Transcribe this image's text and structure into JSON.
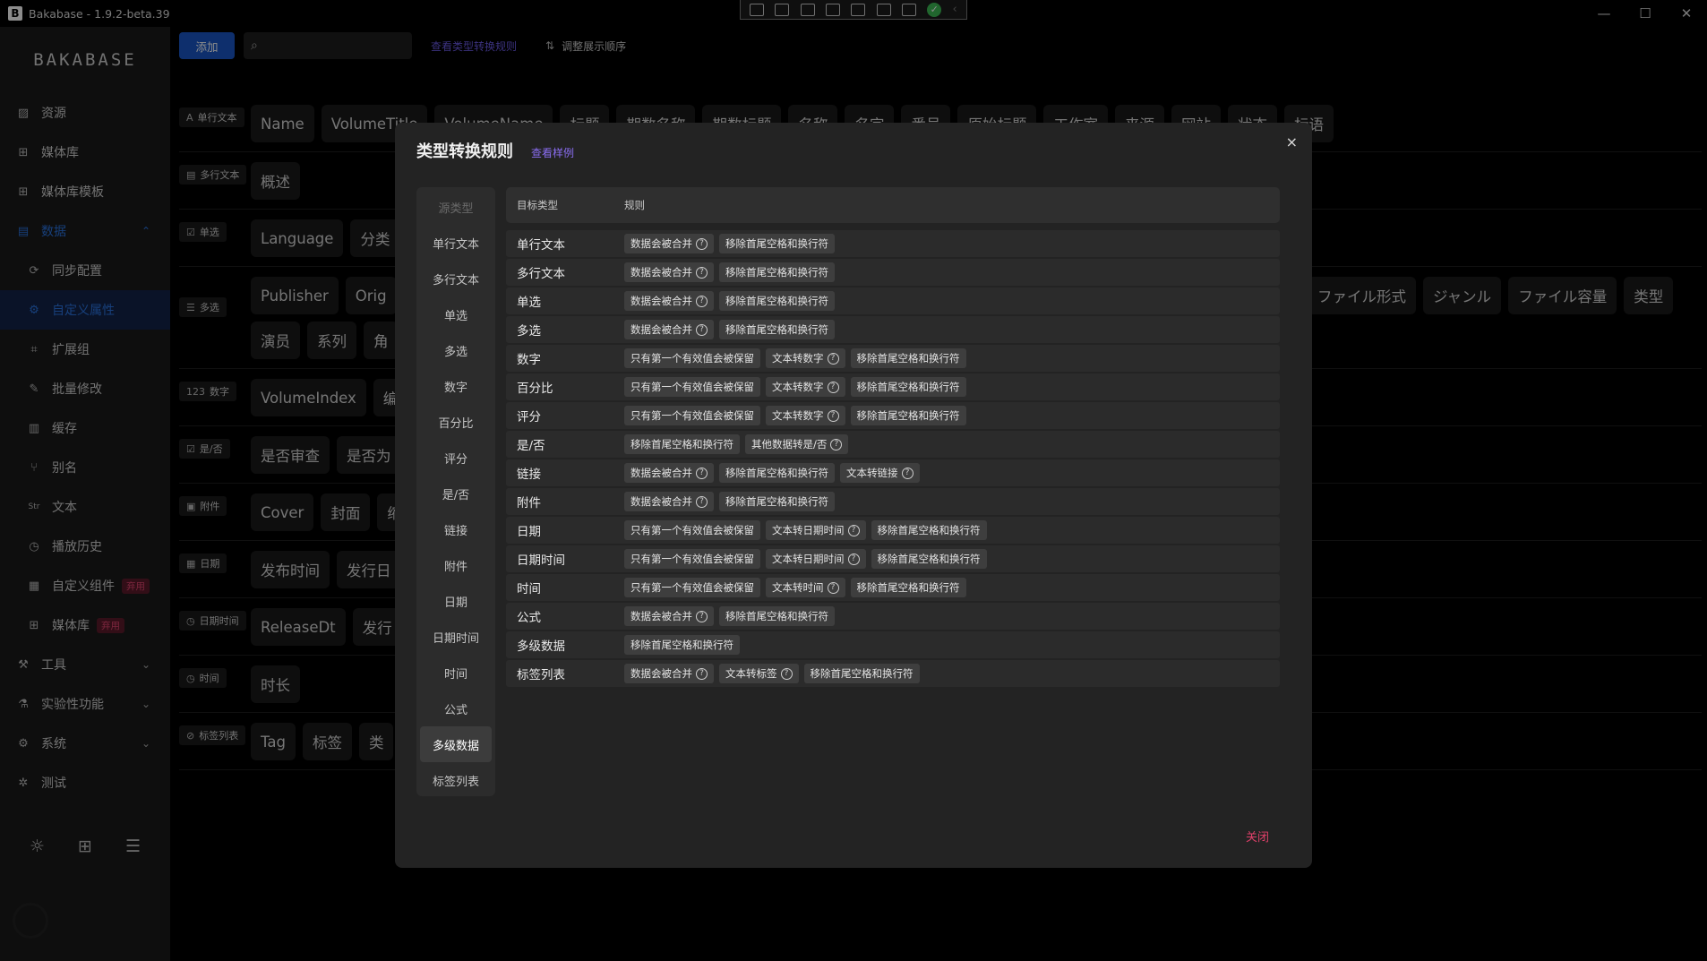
{
  "app": {
    "icon_letter": "B",
    "title": "Bakabase - 1.9.2-beta.39"
  },
  "window": {
    "minimize": "—",
    "maximize": "☐",
    "close": "✕"
  },
  "sidebar": {
    "logo": "BAKABASE",
    "items": [
      {
        "label": "资源",
        "icon": "image-icon"
      },
      {
        "label": "媒体库",
        "icon": "grid-icon"
      },
      {
        "label": "媒体库模板",
        "icon": "grid-icon"
      },
      {
        "label": "数据",
        "icon": "data-icon",
        "chevron": "⌃"
      },
      {
        "label": "同步配置",
        "icon": "sync-icon"
      },
      {
        "label": "自定义属性",
        "icon": "gear-icon"
      },
      {
        "label": "扩展组",
        "icon": "expand-icon"
      },
      {
        "label": "批量修改",
        "icon": "edit-icon"
      },
      {
        "label": "缓存",
        "icon": "cache-icon"
      },
      {
        "label": "别名",
        "icon": "branch-icon"
      },
      {
        "label": "文本",
        "icon": "text-icon"
      },
      {
        "label": "播放历史",
        "icon": "history-icon"
      },
      {
        "label": "自定义组件",
        "icon": "component-icon",
        "badge": "弃用"
      },
      {
        "label": "媒体库",
        "icon": "grid-icon",
        "badge": "弃用"
      },
      {
        "label": "工具",
        "icon": "tool-icon",
        "chevron": "⌄"
      },
      {
        "label": "实验性功能",
        "icon": "flask-icon",
        "chevron": "⌄"
      },
      {
        "label": "系统",
        "icon": "gear-icon",
        "chevron": "⌄"
      },
      {
        "label": "测试",
        "icon": "bug-icon"
      }
    ]
  },
  "toolbar": {
    "add_label": "添加",
    "search_placeholder": "",
    "view_rules_link": "查看类型转换规则",
    "sort_label": "调整展示顺序"
  },
  "property_rows": [
    {
      "type": "单行文本",
      "icon": "A",
      "chips": [
        "Name",
        "VolumeTitle",
        "VolumeName",
        "标题",
        "期数名称",
        "期数标题",
        "名称",
        "名字",
        "番号",
        "原始标题",
        "工作室",
        "来源",
        "网站",
        "状态",
        "标语"
      ]
    },
    {
      "type": "多行文本",
      "icon": "▤",
      "chips": [
        "概述"
      ]
    },
    {
      "type": "单选",
      "icon": "☑",
      "chips": [
        "Language",
        "分类"
      ]
    },
    {
      "type": "多选",
      "icon": "☰",
      "chips": [
        "Publisher",
        "Orig"
      ],
      "chips_right": [
        "ファイル形式",
        "ジャンル",
        "ファイル容量",
        "类型"
      ],
      "chips2": [
        "演员",
        "系列",
        "角"
      ]
    },
    {
      "type": "数字",
      "icon": "123",
      "chips": [
        "VolumeIndex",
        "编"
      ]
    },
    {
      "type": "是/否",
      "icon": "☑",
      "chips": [
        "是否审查",
        "是否为"
      ]
    },
    {
      "type": "附件",
      "icon": "▣",
      "chips": [
        "Cover",
        "封面",
        "缩"
      ]
    },
    {
      "type": "日期",
      "icon": "▦",
      "chips": [
        "发布时间",
        "发行日"
      ]
    },
    {
      "type": "日期时间",
      "icon": "◷",
      "chips": [
        "ReleaseDt",
        "发行"
      ]
    },
    {
      "type": "时间",
      "icon": "◷",
      "chips": [
        "时长"
      ]
    },
    {
      "type": "标签列表",
      "icon": "⊘",
      "chips": [
        "Tag",
        "标签",
        "类"
      ]
    }
  ],
  "modal": {
    "title": "类型转换规则",
    "example_link": "查看样例",
    "close_x": "×",
    "close_button": "关闭",
    "source_header": "源类型",
    "source_types": [
      "单行文本",
      "多行文本",
      "单选",
      "多选",
      "数字",
      "百分比",
      "评分",
      "是/否",
      "链接",
      "附件",
      "日期",
      "日期时间",
      "时间",
      "公式",
      "多级数据",
      "标签列表"
    ],
    "selected_source": "多级数据",
    "columns": {
      "target": "目标类型",
      "rule": "规则"
    },
    "rules": [
      {
        "target": "单行文本",
        "tags": [
          {
            "text": "数据会被合并",
            "help": true
          },
          {
            "text": "移除首尾空格和换行符",
            "help": false
          }
        ]
      },
      {
        "target": "多行文本",
        "tags": [
          {
            "text": "数据会被合并",
            "help": true
          },
          {
            "text": "移除首尾空格和换行符",
            "help": false
          }
        ]
      },
      {
        "target": "单选",
        "tags": [
          {
            "text": "数据会被合并",
            "help": true
          },
          {
            "text": "移除首尾空格和换行符",
            "help": false
          }
        ]
      },
      {
        "target": "多选",
        "tags": [
          {
            "text": "数据会被合并",
            "help": true
          },
          {
            "text": "移除首尾空格和换行符",
            "help": false
          }
        ]
      },
      {
        "target": "数字",
        "tags": [
          {
            "text": "只有第一个有效值会被保留",
            "help": false
          },
          {
            "text": "文本转数字",
            "help": true
          },
          {
            "text": "移除首尾空格和换行符",
            "help": false
          }
        ]
      },
      {
        "target": "百分比",
        "tags": [
          {
            "text": "只有第一个有效值会被保留",
            "help": false
          },
          {
            "text": "文本转数字",
            "help": true
          },
          {
            "text": "移除首尾空格和换行符",
            "help": false
          }
        ]
      },
      {
        "target": "评分",
        "tags": [
          {
            "text": "只有第一个有效值会被保留",
            "help": false
          },
          {
            "text": "文本转数字",
            "help": true
          },
          {
            "text": "移除首尾空格和换行符",
            "help": false
          }
        ]
      },
      {
        "target": "是/否",
        "tags": [
          {
            "text": "移除首尾空格和换行符",
            "help": false
          },
          {
            "text": "其他数据转是/否",
            "help": true
          }
        ]
      },
      {
        "target": "链接",
        "tags": [
          {
            "text": "数据会被合并",
            "help": true
          },
          {
            "text": "移除首尾空格和换行符",
            "help": false
          },
          {
            "text": "文本转链接",
            "help": true
          }
        ]
      },
      {
        "target": "附件",
        "tags": [
          {
            "text": "数据会被合并",
            "help": true
          },
          {
            "text": "移除首尾空格和换行符",
            "help": false
          }
        ]
      },
      {
        "target": "日期",
        "tags": [
          {
            "text": "只有第一个有效值会被保留",
            "help": false
          },
          {
            "text": "文本转日期时间",
            "help": true
          },
          {
            "text": "移除首尾空格和换行符",
            "help": false
          }
        ]
      },
      {
        "target": "日期时间",
        "tags": [
          {
            "text": "只有第一个有效值会被保留",
            "help": false
          },
          {
            "text": "文本转日期时间",
            "help": true
          },
          {
            "text": "移除首尾空格和换行符",
            "help": false
          }
        ]
      },
      {
        "target": "时间",
        "tags": [
          {
            "text": "只有第一个有效值会被保留",
            "help": false
          },
          {
            "text": "文本转时间",
            "help": true
          },
          {
            "text": "移除首尾空格和换行符",
            "help": false
          }
        ]
      },
      {
        "target": "公式",
        "tags": [
          {
            "text": "数据会被合并",
            "help": true
          },
          {
            "text": "移除首尾空格和换行符",
            "help": false
          }
        ]
      },
      {
        "target": "多级数据",
        "tags": [
          {
            "text": "移除首尾空格和换行符",
            "help": false
          }
        ]
      },
      {
        "target": "标签列表",
        "tags": [
          {
            "text": "数据会被合并",
            "help": true
          },
          {
            "text": "文本转标签",
            "help": true
          },
          {
            "text": "移除首尾空格和换行符",
            "help": false
          }
        ]
      }
    ]
  },
  "colors": {
    "accent": "#1a57c6",
    "link": "#8a6df0",
    "danger": "#e0406a",
    "success": "#3cba54"
  }
}
